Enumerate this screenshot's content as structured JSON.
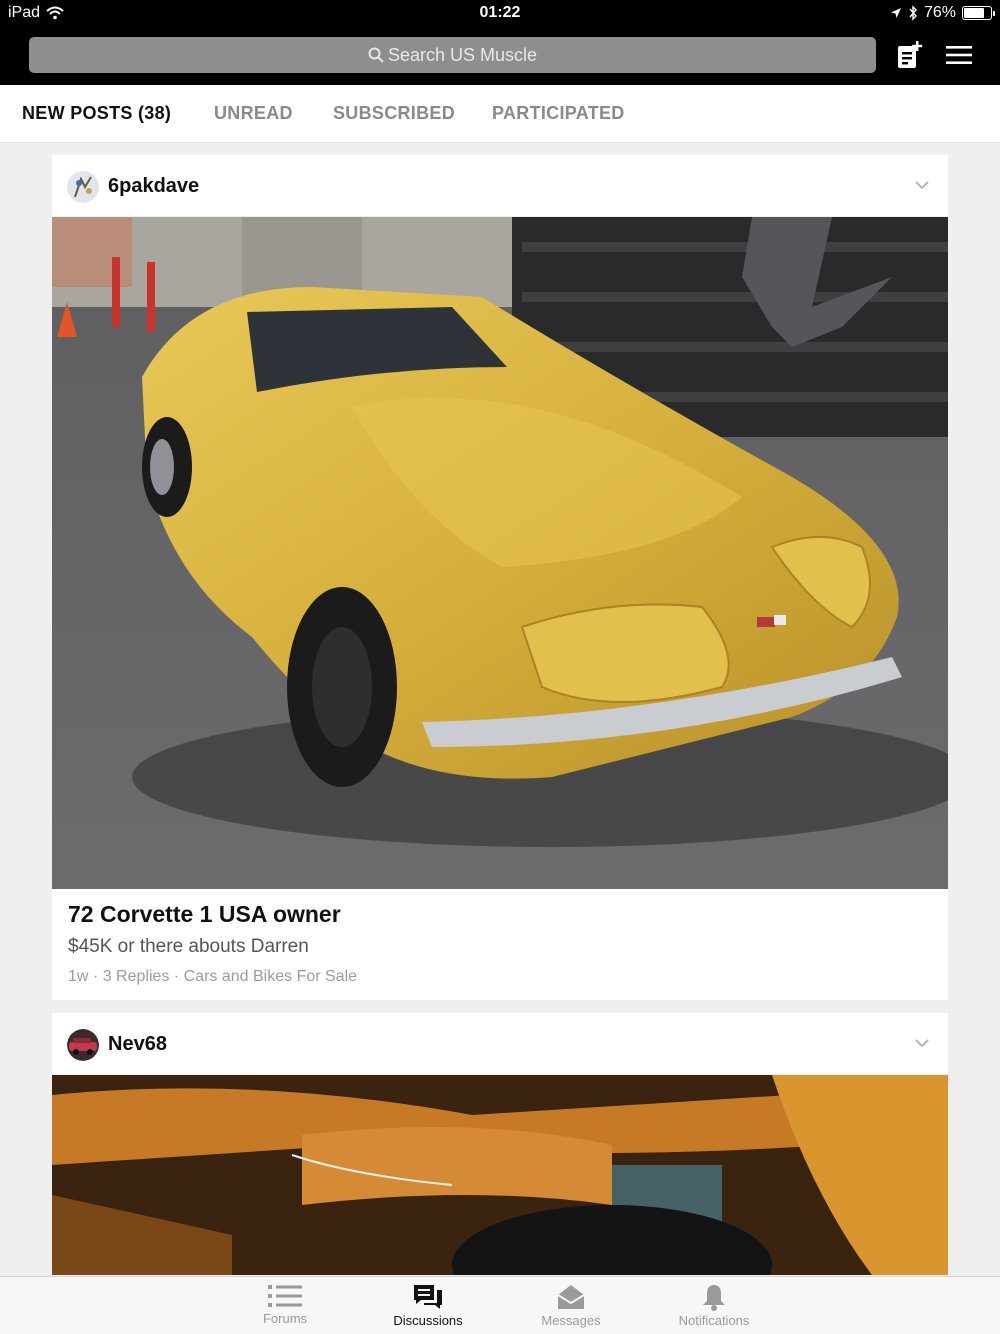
{
  "status_bar": {
    "device": "iPad",
    "time": "01:22",
    "battery": "76%",
    "battery_level": 0.76
  },
  "header": {
    "search_placeholder": "Search US Muscle"
  },
  "tabs": [
    {
      "label": "NEW POSTS (38)",
      "active": true
    },
    {
      "label": "UNREAD",
      "active": false
    },
    {
      "label": "SUBSCRIBED",
      "active": false
    },
    {
      "label": "PARTICIPATED",
      "active": false
    }
  ],
  "posts": [
    {
      "username": "6pakdave",
      "title": "72 Corvette 1 USA owner",
      "excerpt": "$45K or there abouts Darren",
      "time": "1w",
      "replies": "3 Replies",
      "forum": "Cars and Bikes For Sale",
      "sep": "·"
    },
    {
      "username": "Nev68"
    }
  ],
  "bottom_tabs": [
    {
      "label": "Forums",
      "icon": "list-icon",
      "active": false
    },
    {
      "label": "Discussions",
      "icon": "chat-bubbles-icon",
      "active": true
    },
    {
      "label": "Messages",
      "icon": "envelope-icon",
      "active": false
    },
    {
      "label": "Notifications",
      "icon": "bell-icon",
      "active": false
    }
  ],
  "colors": {
    "bar_background": "#000000",
    "search_field": "#8e8e8e",
    "active_text": "#111111",
    "inactive_text": "#8a8a8a",
    "car_yellow": "#d9b43a"
  }
}
